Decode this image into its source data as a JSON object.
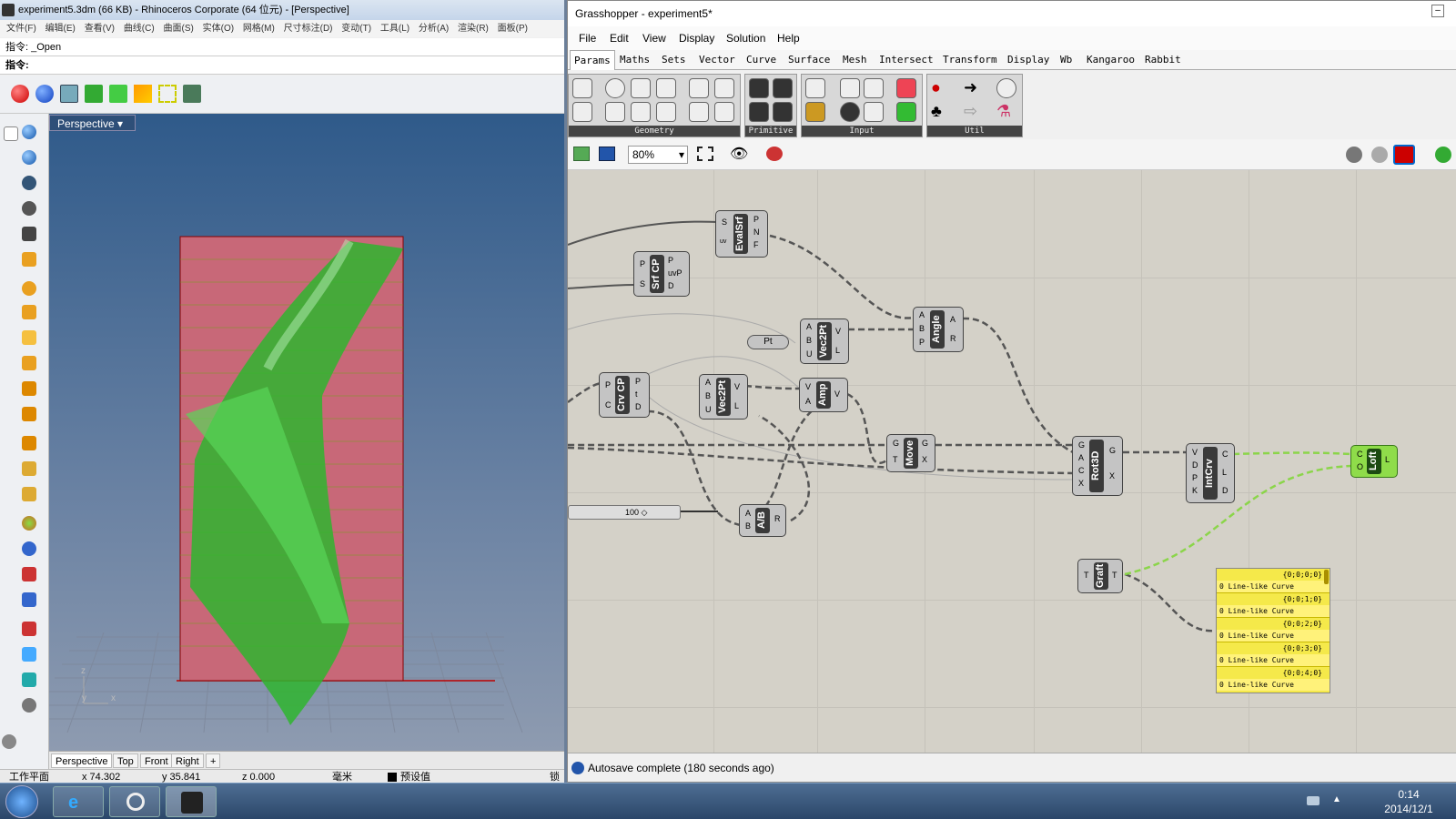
{
  "rhino": {
    "title": "experiment5.3dm (66 KB) - Rhinoceros Corporate (64 位元) - [Perspective]",
    "menu": [
      "文件(F)",
      "编辑(E)",
      "查看(V)",
      "曲线(C)",
      "曲面(S)",
      "实体(O)",
      "网格(M)",
      "尺寸标注(D)",
      "变动(T)",
      "工具(L)",
      "分析(A)",
      "渲染(R)",
      "面板(P)"
    ],
    "cmd_history": "指令: _Open",
    "cmd_prompt": "指令:",
    "viewport_label": "Perspective",
    "view_tabs": [
      "Perspective",
      "Top",
      "Front",
      "Right"
    ],
    "status": {
      "plane": "工作平面",
      "x": "x 74.302",
      "y": "y 35.841",
      "z": "z 0.000",
      "unit": "毫米",
      "layer": "预设值",
      "lock": "锁"
    }
  },
  "grasshopper": {
    "title": "Grasshopper - experiment5*",
    "menu": [
      "File",
      "Edit",
      "View",
      "Display",
      "Solution",
      "Help"
    ],
    "tabs": [
      "Params",
      "Maths",
      "Sets",
      "Vector",
      "Curve",
      "Surface",
      "Mesh",
      "Intersect",
      "Transform",
      "Display",
      "Wb",
      "Kangaroo",
      "Rabbit"
    ],
    "ribbon_groups": [
      "Geometry",
      "Primitive",
      "Input",
      "Util"
    ],
    "zoom": "80%",
    "status": "Autosave complete (180 seconds ago)",
    "components": {
      "evalsrf": "EvalSrf",
      "srfcp": "Srf CP",
      "vec2pt1": "Vec2Pt",
      "angle": "Angle",
      "crvcp": "Crv CP",
      "vec2pt2": "Vec2Pt",
      "amp": "Amp",
      "move": "Move",
      "rot3d": "Rot3D",
      "intcrv": "IntCrv",
      "loft": "Loft",
      "ab": "A/B",
      "graft": "Graft",
      "pt": "Pt",
      "slider": "100"
    },
    "panel": {
      "rows": [
        {
          "path": "{0;0;0;0}",
          "val": "0 Line-like Curve"
        },
        {
          "path": "{0;0;1;0}",
          "val": "0 Line-like Curve"
        },
        {
          "path": "{0;0;2;0}",
          "val": "0 Line-like Curve"
        },
        {
          "path": "{0;0;3;0}",
          "val": "0 Line-like Curve"
        },
        {
          "path": "{0;0;4;0}",
          "val": "0 Line-like Curve"
        }
      ]
    }
  },
  "taskbar": {
    "time": "0:14",
    "date": "2014/12/1"
  }
}
